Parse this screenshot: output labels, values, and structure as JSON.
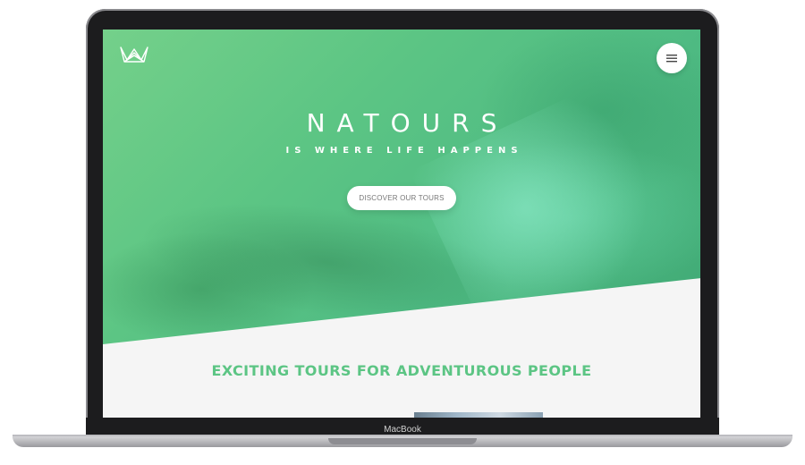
{
  "device": {
    "brand_label": "MacBook"
  },
  "header": {
    "logo_icon": "crown-logo-icon",
    "menu_icon": "hamburger-menu-icon"
  },
  "hero": {
    "title": "NATOURS",
    "subtitle": "IS WHERE LIFE HAPPENS",
    "cta_label": "DISCOVER OUR TOURS"
  },
  "main": {
    "section_title": "EXCITING TOURS FOR ADVENTUROUS PEOPLE"
  },
  "colors": {
    "accent": "#5cc584",
    "hero_light": "#74d08a",
    "hero_dark": "#3fa874"
  }
}
